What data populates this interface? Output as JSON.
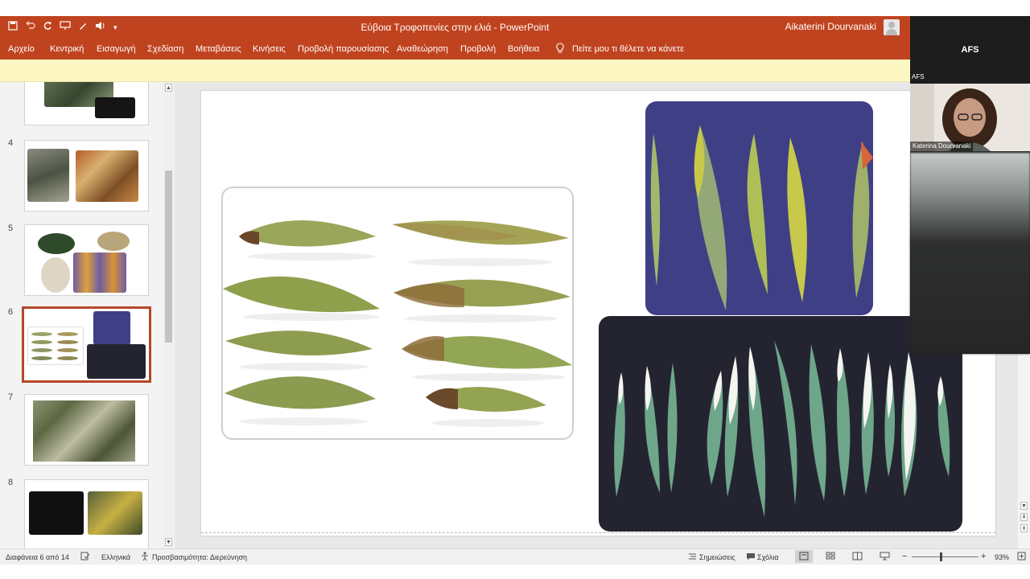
{
  "app": {
    "document_title": "Εύβοια Τροφοπενίες στην ελιά  -  PowerPoint",
    "user_name": "Aikaterini Dourvanaki",
    "qat_icons": [
      "save-icon",
      "undo-icon",
      "redo-icon",
      "present-icon",
      "pen-icon",
      "speaker-icon",
      "customize-icon"
    ]
  },
  "ribbon": {
    "tabs": [
      "Αρχείο",
      "Κεντρική",
      "Εισαγωγή",
      "Σχεδίαση",
      "Μεταβάσεις",
      "Κινήσεις",
      "Προβολή παρουσίασης",
      "Αναθεώρηση",
      "Προβολή",
      "Βοήθεια"
    ],
    "tell_me": "Πείτε μου τι θέλετε να κάνετε"
  },
  "slides_panel": {
    "numbers": [
      "4",
      "5",
      "6",
      "7",
      "8"
    ],
    "selected": "6"
  },
  "status": {
    "slide_of": "Διαφάνεια 6 από 14",
    "language": "Ελληνικά",
    "accessibility": "Προσβασιμότητα: Διερεύνηση",
    "notes": "Σημειώσεις",
    "comments": "Σχόλια",
    "zoom": "93%"
  },
  "call": {
    "host_label": "AFS",
    "tile_label": "AFS",
    "participant": "Katerina Dourvanaki"
  },
  "colors": {
    "accent": "#c0431f",
    "selected_border": "#b7472a",
    "infobar": "#fcf7c3"
  }
}
